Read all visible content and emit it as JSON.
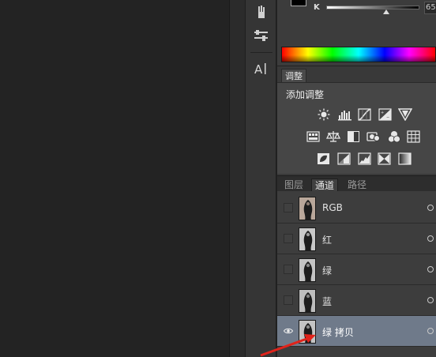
{
  "color_panel": {
    "channel_label": "K",
    "value_text": "65",
    "slider_value_percent": 65
  },
  "adjustments": {
    "tab_label": "调整",
    "title": "添加调整",
    "icons": [
      [
        "brightness-contrast-icon",
        "levels-icon",
        "curves-icon",
        "exposure-icon",
        "vibrance-icon"
      ],
      [
        "hue-saturation-icon",
        "color-balance-icon",
        "black-white-icon",
        "photo-filter-icon",
        "channel-mixer-icon",
        "color-lookup-icon"
      ],
      [
        "invert-icon",
        "posterize-icon",
        "threshold-icon",
        "selective-color-icon",
        "gradient-map-icon"
      ]
    ]
  },
  "layer_tabs": {
    "layers": "图层",
    "channels": "通道",
    "paths": "路径",
    "active": "channels"
  },
  "channels": [
    {
      "name": "RGB",
      "visible": false,
      "selected": false
    },
    {
      "name": "红",
      "visible": false,
      "selected": false
    },
    {
      "name": "绿",
      "visible": false,
      "selected": false
    },
    {
      "name": "蓝",
      "visible": false,
      "selected": false
    },
    {
      "name": "绿 拷贝",
      "visible": true,
      "selected": true
    }
  ],
  "colors": {
    "selected_row": "#6f7a8a",
    "arrow": "#e0231b"
  }
}
